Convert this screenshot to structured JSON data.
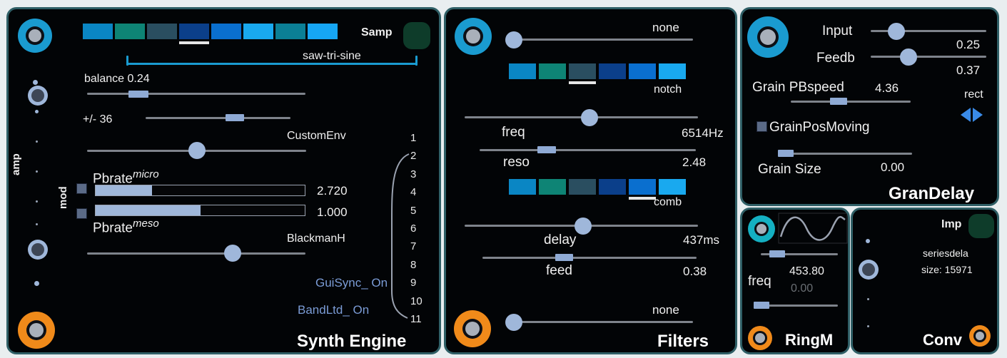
{
  "colors": {
    "panel_border": "#2f5f66",
    "accent_blue": "#1a9bd0",
    "accent_orange": "#f08a1a",
    "slider_thumb": "#9fb7da",
    "link_blue": "#7b9cd6"
  },
  "synth_engine": {
    "title": "Synth Engine",
    "samp_label": "Samp",
    "waveform_label": "saw-tri-sine",
    "swatches": [
      "#0a86c4",
      "#0e8475",
      "#2a4e60",
      "#0b3f8a",
      "#0a6fcf",
      "#19a9ef",
      "#0b7f95",
      "#16a6f4"
    ],
    "selected_swatch": 3,
    "balance_label": "balance 0.24",
    "balance": 0.24,
    "range_label": "+/- 36",
    "env1_label": "CustomEnv",
    "pbrate_micro_label": "Pbrate",
    "pbrate_micro_sup": "micro",
    "pbrate_micro_value": "2.720",
    "pbrate_micro_fill": 0.27,
    "pbrate_meso_label": "Pbrate",
    "pbrate_meso_sup": "meso",
    "pbrate_meso_value": "1.000",
    "pbrate_meso_fill": 0.5,
    "env2_label": "BlackmanH",
    "amp_label": "amp",
    "mod_label": "mod",
    "numbers": [
      "1",
      "2",
      "3",
      "4",
      "5",
      "6",
      "7",
      "8",
      "9",
      "10",
      "11"
    ],
    "gui_sync_label": "GuiSync_ On",
    "band_ltd_label": "BandLtd_ On"
  },
  "filters": {
    "title": "Filters",
    "top_select": "none",
    "filter1_swatches": [
      "#0a86c4",
      "#0e8475",
      "#2a4e60",
      "#0b3f8a",
      "#0a6fcf",
      "#19a9ef"
    ],
    "filter1_selected": 2,
    "filter1_type": "notch",
    "freq_label": "freq",
    "freq_value": "6514Hz",
    "reso_label": "reso",
    "reso_value": "2.48",
    "filter2_swatches": [
      "#0a86c4",
      "#0e8475",
      "#2a4e60",
      "#0b3f8a",
      "#0a6fcf",
      "#19a9ef"
    ],
    "filter2_selected": 4,
    "filter2_type": "comb",
    "delay_label": "delay",
    "delay_value": "437ms",
    "feed_label": "feed",
    "feed_value": "0.38",
    "bottom_select": "none"
  },
  "gran_delay": {
    "title": "GranDelay",
    "input_label": "Input",
    "input_value": "0.25",
    "feedb_label": "Feedb",
    "feedb_value": "0.37",
    "pbspeed_label": "Grain PBspeed",
    "pbspeed_value": "4.36",
    "window_label": "rect",
    "grainpos_label": "GrainPosMoving",
    "grain_size_label": "Grain Size",
    "grain_size_value": "0.00"
  },
  "ring_mod": {
    "title": "RingM",
    "freq_label": "freq",
    "freq_value": "453.80",
    "freq2_value": "0.00"
  },
  "conv": {
    "title": "Conv",
    "imp_label": "Imp",
    "file_name": "seriesdela",
    "size_label": "size: 15971"
  }
}
